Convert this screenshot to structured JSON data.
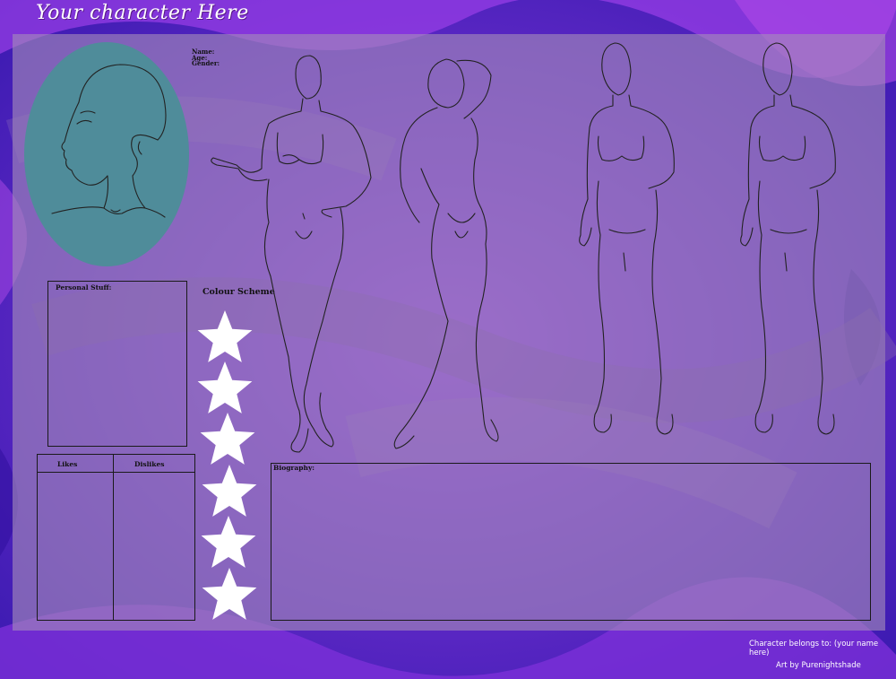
{
  "title": "Your character Here",
  "info": {
    "name_label": "Name:",
    "age_label": "Age:",
    "gender_label": "Gender:"
  },
  "sections": {
    "personal_stuff": "Personal Stuff:",
    "colour_scheme": "Colour Scheme",
    "likes": "Likes",
    "dislikes": "Dislikes",
    "biography": "Biography:"
  },
  "footer": {
    "belongs": "Character belongs to: (your name here)",
    "credit": "Art by Purenightshade"
  },
  "colors": {
    "background": "#6a2ad0",
    "panel": "#a58cb9",
    "portrait_oval": "#4f8c9a",
    "star_fill": "#ffffff"
  },
  "icons": [
    "head-portrait-icon",
    "figure-front-icon",
    "figure-back-icon",
    "figure-standing-icon",
    "star-icon"
  ],
  "color_scheme_slots": 6
}
